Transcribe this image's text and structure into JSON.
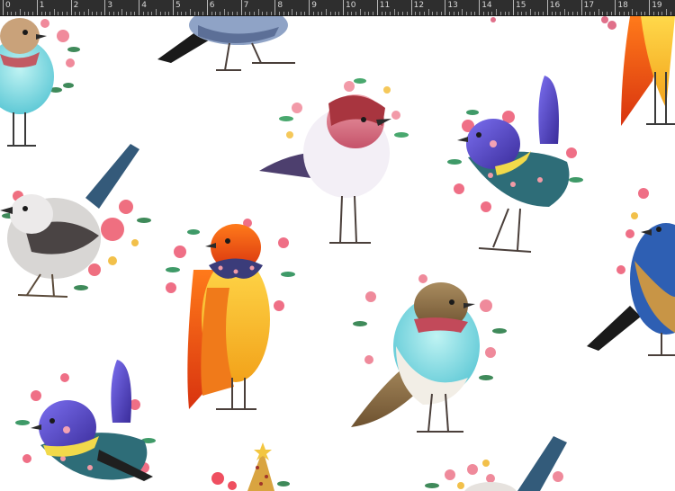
{
  "ruler": {
    "labels": [
      "0",
      "1",
      "2",
      "3",
      "4",
      "5",
      "6",
      "7",
      "8",
      "9",
      "10",
      "11",
      "12",
      "13",
      "14",
      "15",
      "16",
      "17",
      "18",
      "19"
    ]
  },
  "canvas": {
    "description_colors": {
      "background": "#ffffff",
      "ruler_bg": "#2e2e2e",
      "ruler_text": "#d8d8d8"
    },
    "birds": [
      {
        "name": "blue-bird-scarf"
      },
      {
        "name": "grey-wing-bird-top"
      },
      {
        "name": "orange-tail-bird-top-right"
      },
      {
        "name": "pink-headscarf-bird"
      },
      {
        "name": "purple-wren-floral"
      },
      {
        "name": "grey-wren-roses"
      },
      {
        "name": "orange-yellow-bird-bow"
      },
      {
        "name": "brown-blue-bird-scarf"
      },
      {
        "name": "blue-jay-edge"
      },
      {
        "name": "purple-wren-bottom"
      },
      {
        "name": "party-hat-bird"
      },
      {
        "name": "bird-bottom-right"
      }
    ]
  }
}
